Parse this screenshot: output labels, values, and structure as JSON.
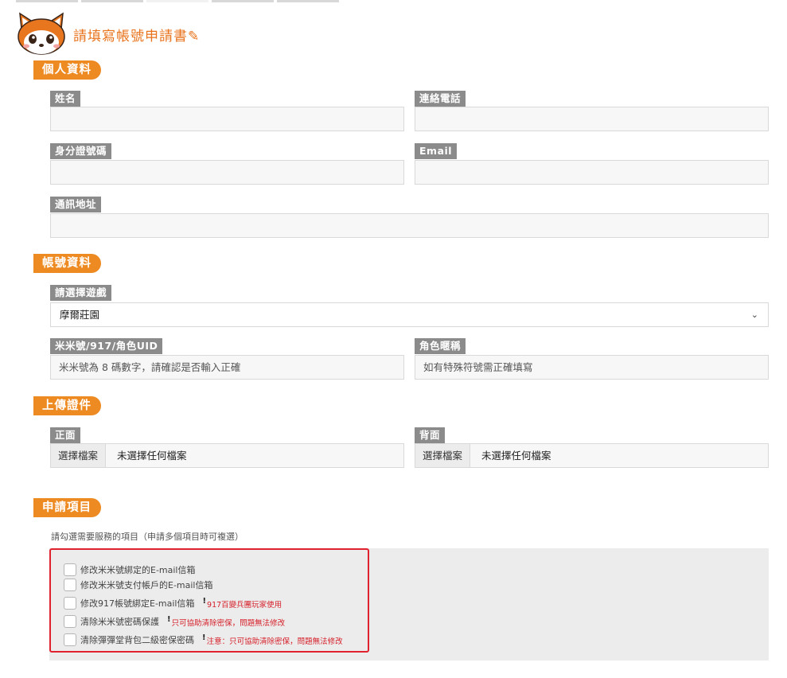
{
  "header": {
    "title": "請填寫帳號申請書✎"
  },
  "sections": {
    "personal": "個人資料",
    "account": "帳號資料",
    "upload": "上傳證件",
    "apply": "申請項目"
  },
  "personal": {
    "name_label": "姓名",
    "phone_label": "連絡電話",
    "id_label": "身分證號碼",
    "email_label": "Email",
    "address_label": "通訊地址"
  },
  "account": {
    "game_label": "請選擇遊戲",
    "game_selected": "摩爾莊園",
    "uid_label": "米米號/917/角色UID",
    "uid_placeholder": "米米號為 8 碼數字，請確認是否輸入正確",
    "nickname_label": "角色暱稱",
    "nickname_placeholder": "如有特殊符號需正確填寫"
  },
  "upload": {
    "front_label": "正面",
    "back_label": "背面",
    "choose_file": "選擇檔案",
    "no_file": "未選擇任何檔案"
  },
  "apply": {
    "hint": "請勾選需要服務的項目（申請多個項目時可複選）",
    "items": [
      {
        "label": "修改米米號綁定的E-mail信箱",
        "note": ""
      },
      {
        "label": "修改米米號支付帳戶的E-mail信箱",
        "note": ""
      },
      {
        "label": "修改917帳號綁定E-mail信箱",
        "note": "917百變兵團玩家使用"
      },
      {
        "label": "清除米米號密碼保護",
        "note": "只可協助清除密保，問題無法修改"
      },
      {
        "label": "清除彈彈堂背包二級密保密碼",
        "note": "注意：只可協助清除密保，問題無法修改"
      }
    ]
  },
  "colors": {
    "accent": "#ee8a22",
    "label_bg": "#8b8b8b",
    "highlight_border": "#e0222e",
    "note_text": "#d6202a"
  }
}
